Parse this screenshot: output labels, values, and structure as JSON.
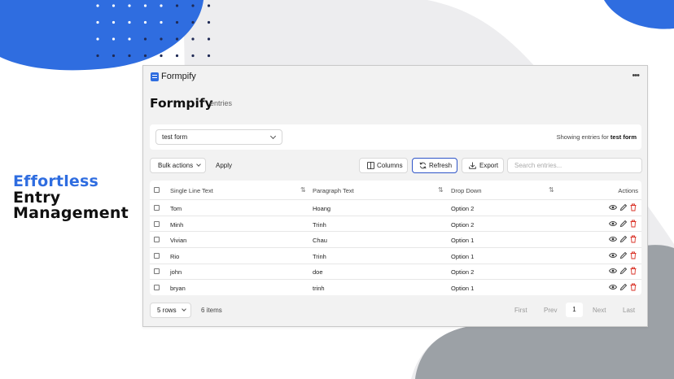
{
  "hero": {
    "headline_accent": "Effortless",
    "headline_line2": "Entry",
    "headline_line3": "Management"
  },
  "colors": {
    "accent_blue": "#2f6de0",
    "blob_gray": "#9ca1a6",
    "dot_navy": "#1f2a55",
    "delete_red": "#d93025"
  },
  "app": {
    "name": "Formpify",
    "menu_icon": "more-dots-icon",
    "page_title": "Formpify",
    "page_subtitle": "entries"
  },
  "form_selector": {
    "value": "test form",
    "showing_prefix": "Showing entries for",
    "showing_form": "test form"
  },
  "toolbar": {
    "bulk_label": "Bulk actions",
    "apply_label": "Apply",
    "columns_label": "Columns",
    "refresh_label": "Refresh",
    "export_label": "Export",
    "search_placeholder": "Search entries..."
  },
  "table": {
    "columns": [
      "Single Line Text",
      "Paragraph Text",
      "Drop Down",
      "Actions"
    ],
    "rows": [
      [
        "Tom",
        "Hoang",
        "Option 2"
      ],
      [
        "Minh",
        "Trinh",
        "Option 2"
      ],
      [
        "Vivian",
        "Chau",
        "Option 1"
      ],
      [
        "Rio",
        "Trinh",
        "Option 1"
      ],
      [
        "john",
        "doe",
        "Option 2"
      ],
      [
        "bryan",
        "trinh",
        "Option 1"
      ]
    ]
  },
  "pagination": {
    "rows_per_page": "5 rows",
    "items_count": "6 items",
    "first": "First",
    "prev": "Prev",
    "current_page": "1",
    "next": "Next",
    "last": "Last"
  }
}
